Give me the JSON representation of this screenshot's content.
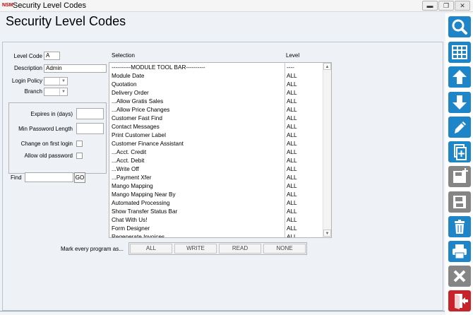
{
  "window": {
    "title": "Security Level Codes",
    "app_icon_text": "NSM",
    "minimize_label": "▬",
    "maximize_label": "❐",
    "close_label": "✕"
  },
  "page": {
    "title": "Security Level Codes"
  },
  "form": {
    "level_code_label": "Level Code",
    "level_code_value": "A",
    "description_label": "Description",
    "description_value": "Admin",
    "login_policy_label": "Login Policy",
    "login_policy_value": "",
    "branch_label": "Branch",
    "branch_value": "",
    "expires_label": "Expires in (days)",
    "expires_value": "",
    "min_password_label": "Min Password Length",
    "min_password_value": "",
    "change_on_first_login_label": "Change on first login",
    "change_on_first_login_checked": false,
    "allow_old_password_label": "Allow old password",
    "allow_old_password_checked": false,
    "find_label": "Find",
    "find_value": "",
    "go_label": "GO"
  },
  "list": {
    "selection_header": "Selection",
    "level_header": "Level",
    "rows": [
      {
        "selection": "----------MODULE TOOL BAR----------",
        "level": "----"
      },
      {
        "selection": "Module Date",
        "level": "ALL"
      },
      {
        "selection": "Quotation",
        "level": "ALL"
      },
      {
        "selection": "Delivery Order",
        "level": "ALL"
      },
      {
        "selection": "...Allow Gratis Sales",
        "level": "ALL"
      },
      {
        "selection": "...Allow Price Changes",
        "level": "ALL"
      },
      {
        "selection": "Customer Fast Find",
        "level": "ALL"
      },
      {
        "selection": "Contact Messages",
        "level": "ALL"
      },
      {
        "selection": "Print Customer Label",
        "level": "ALL"
      },
      {
        "selection": "Customer Finance Assistant",
        "level": "ALL"
      },
      {
        "selection": "...Acct. Credit",
        "level": "ALL"
      },
      {
        "selection": "...Acct. Debit",
        "level": "ALL"
      },
      {
        "selection": "...Write Off",
        "level": "ALL"
      },
      {
        "selection": "...Payment Xfer",
        "level": "ALL"
      },
      {
        "selection": "Mango Mapping",
        "level": "ALL"
      },
      {
        "selection": "Mango Mapping Near By",
        "level": "ALL"
      },
      {
        "selection": "Automated Processing",
        "level": "ALL"
      },
      {
        "selection": "Show Transfer Status Bar",
        "level": "ALL"
      },
      {
        "selection": "Chat With Us!",
        "level": "ALL"
      },
      {
        "selection": "Form Designer",
        "level": "ALL"
      },
      {
        "selection": "Regenerate Invoices",
        "level": "ALL"
      }
    ]
  },
  "mark": {
    "label": "Mark every program as...",
    "all": "ALL",
    "write": "WRITE",
    "read": "READ",
    "none": "NONE"
  },
  "sidebar": {
    "buttons": [
      {
        "name": "search-icon",
        "color": "#1e86c8"
      },
      {
        "name": "table-icon",
        "color": "#1e86c8"
      },
      {
        "name": "arrow-up-icon",
        "color": "#1e86c8"
      },
      {
        "name": "arrow-down-icon",
        "color": "#1e86c8"
      },
      {
        "name": "edit-pencil-icon",
        "color": "#1e86c8"
      },
      {
        "name": "new-document-icon",
        "color": "#1e86c8"
      },
      {
        "name": "save-as-new-icon",
        "color": "#858585"
      },
      {
        "name": "save-icon",
        "color": "#858585"
      },
      {
        "name": "delete-trash-icon",
        "color": "#1e86c8"
      },
      {
        "name": "print-icon",
        "color": "#1e86c8"
      },
      {
        "name": "cancel-icon",
        "color": "#858585"
      },
      {
        "name": "exit-icon",
        "color": "#c8222a"
      }
    ]
  }
}
